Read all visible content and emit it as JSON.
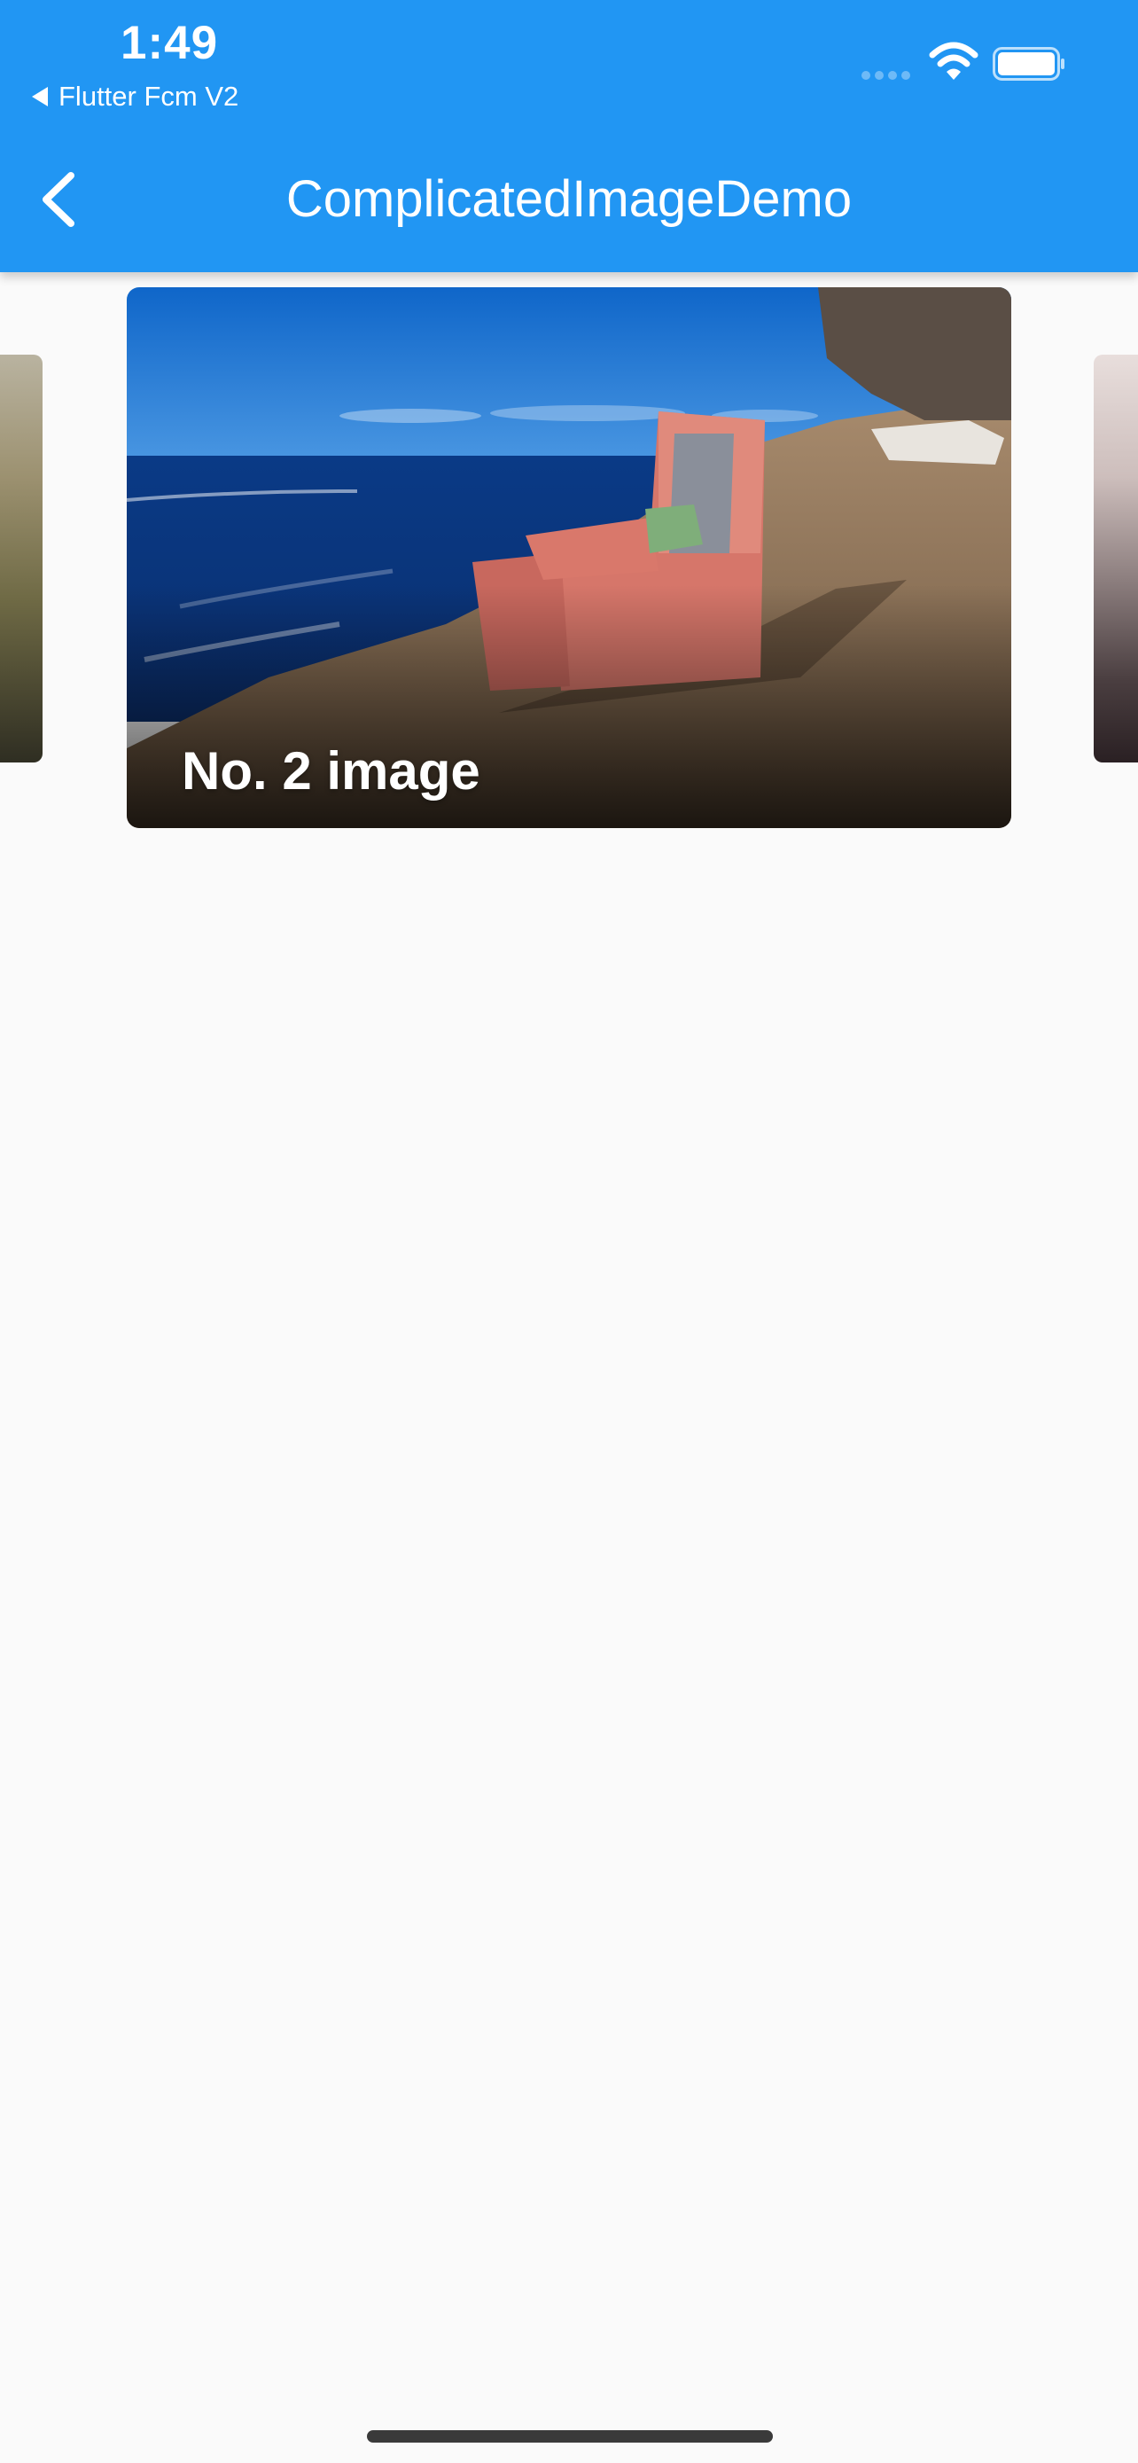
{
  "status_bar": {
    "time": "1:49",
    "back_to_app": "Flutter Fcm V2"
  },
  "app_bar": {
    "title": "ComplicatedImageDemo",
    "color": "#2196f3"
  },
  "carousel": {
    "main_card": {
      "caption": "No. 2 image"
    }
  },
  "icons": {
    "back": "chevron-left",
    "wifi": "wifi",
    "battery": "battery-full"
  }
}
